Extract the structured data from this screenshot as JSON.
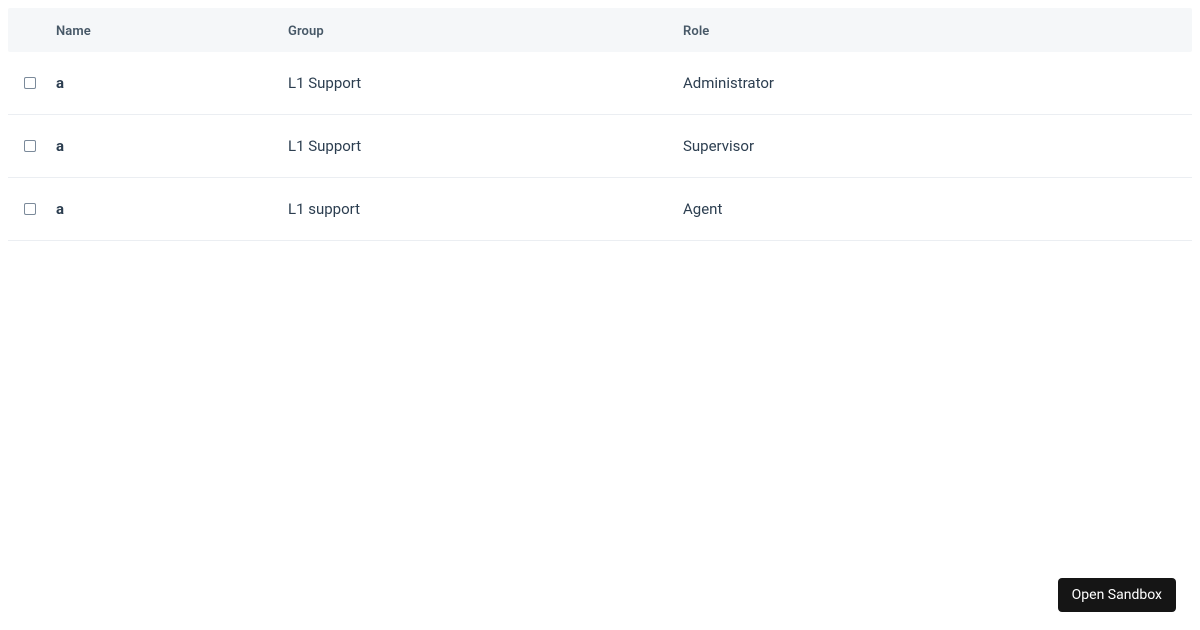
{
  "table": {
    "headers": {
      "name": "Name",
      "group": "Group",
      "role": "Role"
    },
    "rows": [
      {
        "name": "a",
        "group": "L1 Support",
        "role": "Administrator"
      },
      {
        "name": "a",
        "group": "L1 Support",
        "role": "Supervisor"
      },
      {
        "name": "a",
        "group": "L1 support",
        "role": "Agent"
      }
    ]
  },
  "buttons": {
    "open_sandbox": "Open Sandbox"
  }
}
